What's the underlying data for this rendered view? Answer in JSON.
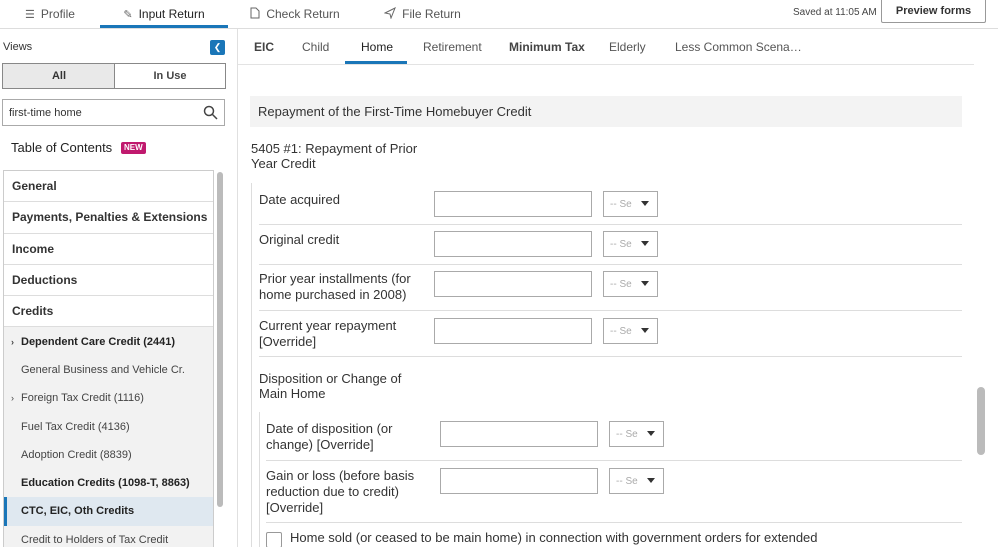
{
  "topnav": {
    "tabs": [
      {
        "label": "Profile",
        "icon": "list-icon"
      },
      {
        "label": "Input Return",
        "icon": "pencil-icon"
      },
      {
        "label": "Check Return",
        "icon": "document-icon"
      },
      {
        "label": "File Return",
        "icon": "send-icon"
      }
    ],
    "saved_text": "Saved at 11:05 AM",
    "preview_label": "Preview forms",
    "accent": "#1a76b8"
  },
  "sidebar": {
    "views_label": "Views",
    "collapse_icon": "chevron-left-icon",
    "segments": [
      "All",
      "In Use"
    ],
    "search_value": "first-time home",
    "search_icon": "search-icon",
    "toc_title": "Table of Contents",
    "toc_badge": "NEW",
    "categories": [
      "General",
      "Payments, Penalties & Extensions",
      "Income",
      "Deductions",
      "Credits"
    ],
    "credit_items": [
      "Dependent Care Credit (2441)",
      "General Business and Vehicle Cr.",
      "Foreign Tax Credit (1116)",
      "Fuel Tax Credit (4136)",
      "Adoption Credit (8839)",
      "Education Credits (1098-T, 8863)",
      "CTC, EIC, Oth Credits",
      "Credit to Holders of Tax Credit"
    ]
  },
  "subtabs": [
    "EIC",
    "Child",
    "Home",
    "Retirement",
    "Minimum Tax",
    "Elderly",
    "Less Common Scena…"
  ],
  "form": {
    "section_title": "Repayment of the First-Time Homebuyer Credit",
    "group1_title": "5405 #1: Repayment of Prior Year Credit",
    "group1_fields": [
      "Date acquired",
      "Original credit",
      "Prior year installments (for home purchased in 2008)",
      "Current year repayment [Override]"
    ],
    "group2_title": "Disposition or Change of Main Home",
    "group2_fields": [
      "Date of disposition (or change) [Override]",
      "Gain or loss (before basis reduction due to credit) [Override]"
    ],
    "select_placeholder": "-- Se",
    "checkbox_label": "Home sold (or ceased to be main home) in connection with government orders for extended"
  }
}
